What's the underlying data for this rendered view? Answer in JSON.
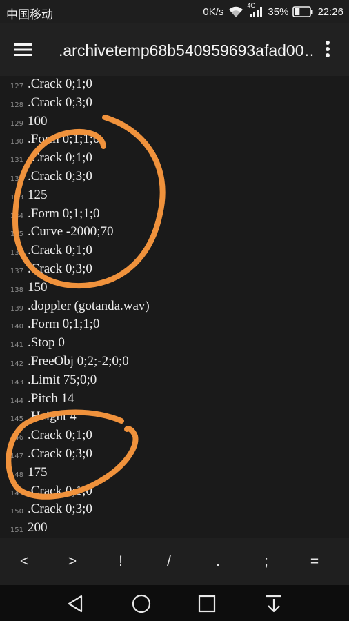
{
  "status_bar": {
    "carrier": "中国移动",
    "network_speed": "0K/s",
    "network_type": "4G",
    "battery_percent": "35%",
    "battery_level": 0.35,
    "time": "22:26"
  },
  "app_bar": {
    "title": ".archivetemp68b540959693afad00…",
    "menu_icon": "hamburger-menu-icon",
    "more_icon": "more-vertical-icon"
  },
  "editor": {
    "lines": [
      {
        "num": "127",
        "text": ".Crack 0;1;0"
      },
      {
        "num": "128",
        "text": ".Crack 0;3;0"
      },
      {
        "num": "129",
        "text": "100"
      },
      {
        "num": "130",
        "text": ".Form 0;1;1;0"
      },
      {
        "num": "131",
        "text": ".Crack 0;1;0"
      },
      {
        "num": "132",
        "text": ".Crack 0;3;0"
      },
      {
        "num": "133",
        "text": "125"
      },
      {
        "num": "134",
        "text": ".Form 0;1;1;0"
      },
      {
        "num": "135",
        "text": ".Curve -2000;70"
      },
      {
        "num": "136",
        "text": ".Crack 0;1;0"
      },
      {
        "num": "137",
        "text": ".Crack 0;3;0"
      },
      {
        "num": "138",
        "text": "150"
      },
      {
        "num": "139",
        "text": ".doppler (gotanda.wav)"
      },
      {
        "num": "140",
        "text": ".Form 0;1;1;0"
      },
      {
        "num": "141",
        "text": ".Stop 0"
      },
      {
        "num": "142",
        "text": ".FreeObj 0;2;-2;0;0"
      },
      {
        "num": "143",
        "text": ".Limit 75;0;0"
      },
      {
        "num": "144",
        "text": ".Pitch 14"
      },
      {
        "num": "145",
        "text": ".Height 4"
      },
      {
        "num": "146",
        "text": ".Crack 0;1;0"
      },
      {
        "num": "147",
        "text": ".Crack 0;3;0"
      },
      {
        "num": "148",
        "text": "175"
      },
      {
        "num": "149",
        "text": ".Crack 0;1;0"
      },
      {
        "num": "150",
        "text": ".Crack 0;3;0"
      },
      {
        "num": "151",
        "text": "200"
      }
    ]
  },
  "annotations": {
    "color": "#f0923c"
  },
  "symbol_bar": {
    "keys": [
      "<",
      ">",
      "!",
      "/",
      ".",
      ";",
      "="
    ]
  },
  "nav_bar": {
    "back_icon": "back-triangle-icon",
    "home_icon": "home-circle-icon",
    "recents_icon": "recents-square-icon",
    "notifications_icon": "pull-down-notifications-icon"
  }
}
